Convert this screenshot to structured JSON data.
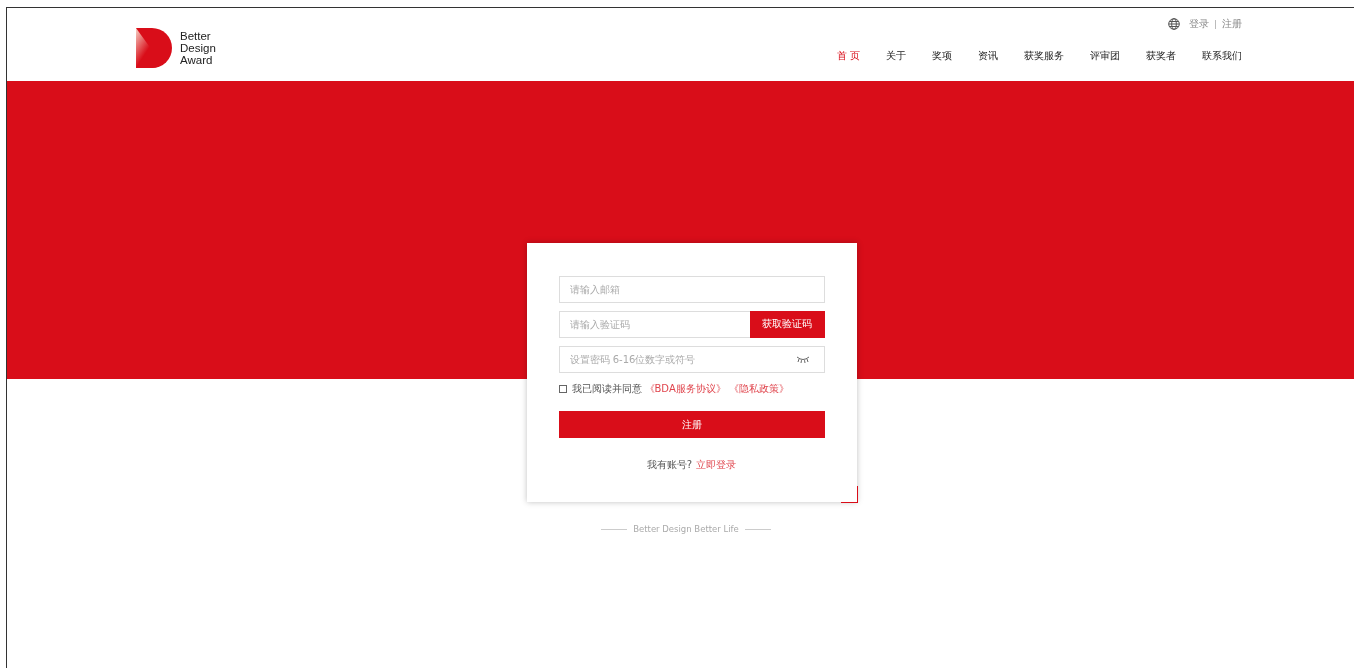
{
  "logo": {
    "lines": [
      "Better",
      "Design",
      "Award"
    ]
  },
  "top_links": [
    "登录",
    "注册"
  ],
  "nav": [
    {
      "label": "首 页",
      "selected": true
    },
    {
      "label": "关于",
      "selected": false
    },
    {
      "label": "奖项",
      "selected": false
    },
    {
      "label": "资讯",
      "selected": false
    },
    {
      "label": "获奖服务",
      "selected": false
    },
    {
      "label": "评审团",
      "selected": false
    },
    {
      "label": "获奖者",
      "selected": false
    },
    {
      "label": "联系我们",
      "selected": false
    }
  ],
  "form": {
    "email": {
      "placeholder": "请输入邮箱"
    },
    "code": {
      "placeholder": "请输入验证码",
      "button": "获取验证码"
    },
    "password": {
      "placeholder": "设置密码 6-16位数字或符号"
    },
    "agree": {
      "checked": false,
      "text": "我已阅读并同意",
      "links": [
        "《BDA服务协议》",
        "《隐私政策》"
      ]
    },
    "submit": "注册",
    "login_prompt": {
      "text": "我有账号?",
      "link": "立即登录"
    }
  },
  "slogan": "Better Design Better Life"
}
